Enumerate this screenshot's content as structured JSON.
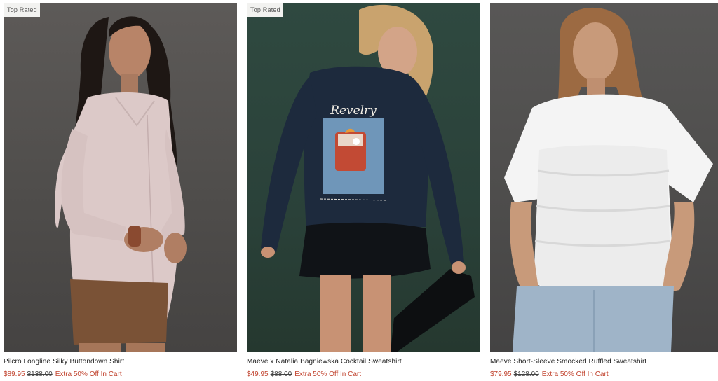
{
  "colors": {
    "sale_price": "#c1432e",
    "promo": "#c1432e",
    "badge_bg": "#f2f2f0"
  },
  "products": [
    {
      "badge": "Top Rated",
      "name": "Pilcro Longline Silky Buttondown Shirt",
      "sale_price": "$89.95",
      "original_price": "$138.00",
      "promo": "Extra 50% Off In Cart"
    },
    {
      "badge": "Top Rated",
      "name": "Maeve x Natalia Bagniewska Cocktail Sweatshirt",
      "sale_price": "$49.95",
      "original_price": "$88.00",
      "promo": "Extra 50% Off In Cart",
      "graphic_text": "Revelry"
    },
    {
      "name": "Maeve Short-Sleeve Smocked Ruffled Sweatshirt",
      "sale_price": "$79.95",
      "original_price": "$128.00",
      "promo": "Extra 50% Off In Cart"
    }
  ]
}
